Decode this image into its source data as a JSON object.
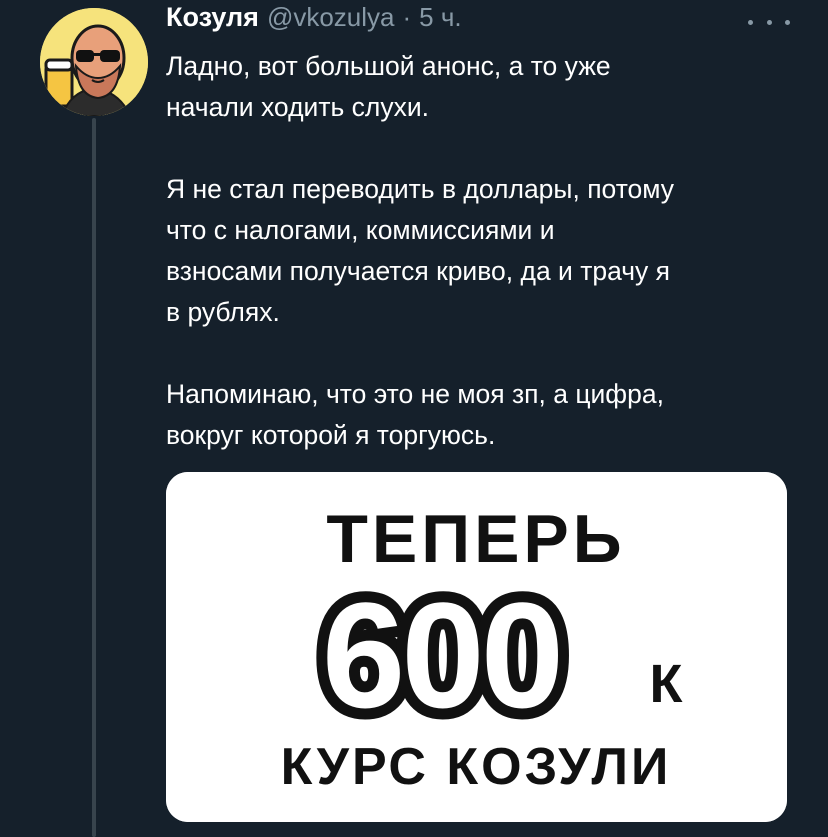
{
  "tweet": {
    "author": {
      "display_name": "Козуля",
      "handle": "@vkozulya",
      "separator": "·",
      "time": "5 ч."
    },
    "text_paragraphs": [
      [
        "Ладно, вот большой анонс, а то уже",
        "начали ходить слухи."
      ],
      [
        "Я не стал переводить в доллары, потому",
        "что с налогами, коммиссиями и",
        "взносами получается криво, да и трачу я",
        "в рублях."
      ],
      [
        "Напоминаю, что это не моя зп, а цифра,",
        "вокруг которой я торгуюсь."
      ]
    ],
    "media": {
      "line1": "ТЕПЕРЬ",
      "number": "600",
      "suffix": "К",
      "line3": "КУРС КОЗУЛИ"
    }
  },
  "colors": {
    "background": "#15202b",
    "secondary_text": "#8899a6",
    "thread_line": "#38444d",
    "avatar_bg": "#f6e37c"
  },
  "icons": {
    "more": "more-horizontal-icon",
    "avatar": "avatar-illustration"
  }
}
